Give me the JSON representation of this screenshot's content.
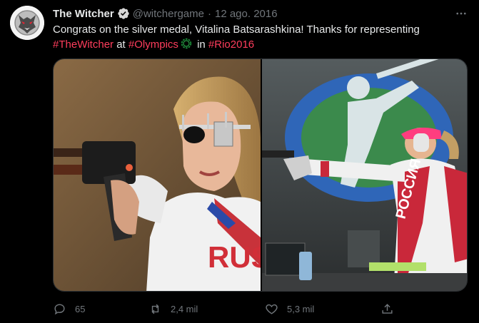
{
  "tweet": {
    "display_name": "The Witcher",
    "handle": "@witchergame",
    "separator": "·",
    "date": "12 ago. 2016",
    "text_line1": "Congrats on the silver medal, Vitalina Batsarashkina! Thanks for representing",
    "hashtag_witcher": "#TheWitcher",
    "word_at": " at ",
    "hashtag_olympics": "#Olympics",
    "word_in": " in ",
    "hashtag_rio": "#Rio2016"
  },
  "media": {
    "left_photo": "shooter-closeup-photo",
    "right_photo": "shooter-aiming-photo",
    "right_jacket_text": "РОССИЯ",
    "left_jacket_text": "RUS"
  },
  "actions": {
    "reply_count": "65",
    "retweet_count": "2,4 mil",
    "like_count": "5,3 mil"
  },
  "colors": {
    "background": "#000000",
    "text": "#e7e9ea",
    "muted": "#71767b",
    "hashtag": "#ff3d5c",
    "verified": "#d9d9d9"
  },
  "icons": {
    "avatar": "witcher-wolf-medallion-icon",
    "verified": "verified-badge-icon",
    "more": "more-dots-icon",
    "reply": "reply-icon",
    "retweet": "retweet-icon",
    "like": "heart-icon",
    "share": "share-icon",
    "olympics": "olympic-wreath-icon"
  }
}
